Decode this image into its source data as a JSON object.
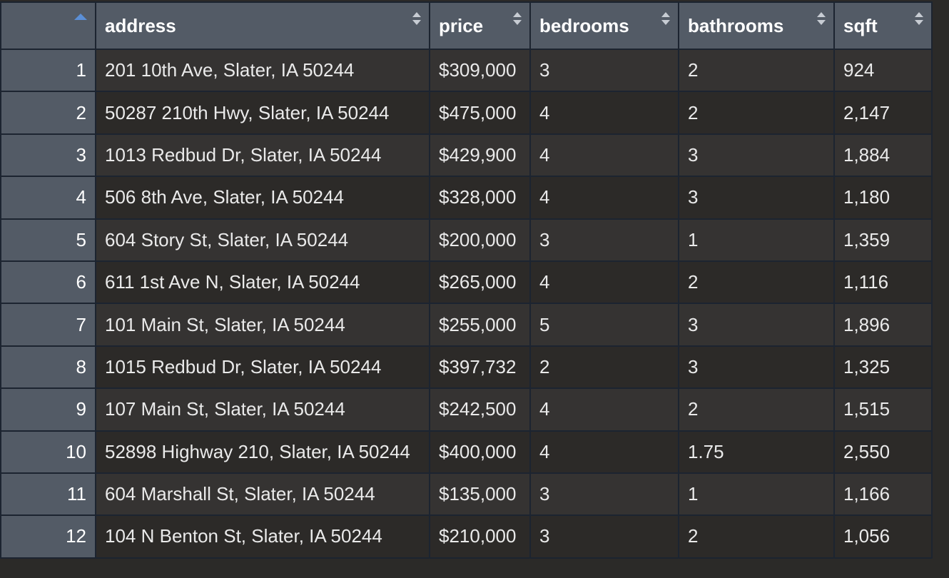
{
  "table": {
    "columns": [
      "address",
      "price",
      "bedrooms",
      "bathrooms",
      "sqft"
    ],
    "rows": [
      {
        "n": "1",
        "address": "201 10th Ave, Slater, IA 50244",
        "price": "$309,000",
        "bedrooms": "3",
        "bathrooms": "2",
        "sqft": "924"
      },
      {
        "n": "2",
        "address": "50287 210th Hwy, Slater, IA 50244",
        "price": "$475,000",
        "bedrooms": "4",
        "bathrooms": "2",
        "sqft": "2,147"
      },
      {
        "n": "3",
        "address": "1013 Redbud Dr, Slater, IA 50244",
        "price": "$429,900",
        "bedrooms": "4",
        "bathrooms": "3",
        "sqft": "1,884"
      },
      {
        "n": "4",
        "address": "506 8th Ave, Slater, IA 50244",
        "price": "$328,000",
        "bedrooms": "4",
        "bathrooms": "3",
        "sqft": "1,180"
      },
      {
        "n": "5",
        "address": "604 Story St, Slater, IA 50244",
        "price": "$200,000",
        "bedrooms": "3",
        "bathrooms": "1",
        "sqft": "1,359"
      },
      {
        "n": "6",
        "address": "611 1st Ave N, Slater, IA 50244",
        "price": "$265,000",
        "bedrooms": "4",
        "bathrooms": "2",
        "sqft": "1,116"
      },
      {
        "n": "7",
        "address": "101 Main St, Slater, IA 50244",
        "price": "$255,000",
        "bedrooms": "5",
        "bathrooms": "3",
        "sqft": "1,896"
      },
      {
        "n": "8",
        "address": "1015 Redbud Dr, Slater, IA 50244",
        "price": "$397,732",
        "bedrooms": "2",
        "bathrooms": "3",
        "sqft": "1,325"
      },
      {
        "n": "9",
        "address": "107 Main St, Slater, IA 50244",
        "price": "$242,500",
        "bedrooms": "4",
        "bathrooms": "2",
        "sqft": "1,515"
      },
      {
        "n": "10",
        "address": "52898 Highway 210, Slater, IA 50244",
        "price": "$400,000",
        "bedrooms": "4",
        "bathrooms": "1.75",
        "sqft": "2,550"
      },
      {
        "n": "11",
        "address": "604 Marshall St, Slater, IA 50244",
        "price": "$135,000",
        "bedrooms": "3",
        "bathrooms": "1",
        "sqft": "1,166"
      },
      {
        "n": "12",
        "address": "104 N Benton St, Slater, IA 50244",
        "price": "$210,000",
        "bedrooms": "3",
        "bathrooms": "2",
        "sqft": "1,056"
      }
    ]
  },
  "icons": {
    "row_header_sort": "sort-ascending-icon",
    "column_sort": "sort-up-down-icon"
  },
  "colors": {
    "header_bg": "#535b66",
    "row_odd_bg": "#353332",
    "row_even_bg": "#2c2a28",
    "border": "#1c2430",
    "sort_asc_accent": "#5b8fd6"
  }
}
